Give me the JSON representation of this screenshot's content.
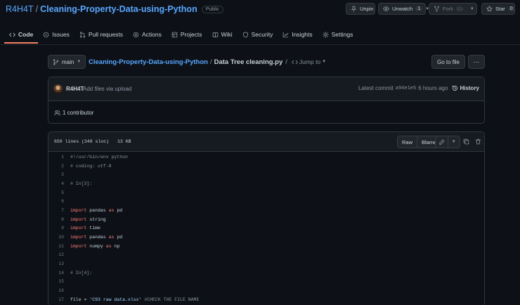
{
  "repo": {
    "owner": "R4H4T",
    "separator": "/",
    "name": "Cleaning-Property-Data-using-Python",
    "visibility": "Public"
  },
  "header_actions": {
    "unpin": "Unpin",
    "unwatch": "Unwatch",
    "watch_count": "1",
    "fork": "Fork",
    "fork_count": "0",
    "star": "Star",
    "star_count": "0"
  },
  "nav": {
    "code": "Code",
    "issues": "Issues",
    "pull_requests": "Pull requests",
    "actions": "Actions",
    "projects": "Projects",
    "wiki": "Wiki",
    "security": "Security",
    "insights": "Insights",
    "settings": "Settings"
  },
  "branch": {
    "name": "main"
  },
  "breadcrumb": {
    "repo": "Cleaning-Property-Data-using-Python",
    "slash": "/",
    "file": "Data Tree cleaning.py",
    "slash2": "/",
    "jump": "Jump to"
  },
  "goto_file": "Go to file",
  "more_options": "···",
  "commit": {
    "author": "R4H4T",
    "message": "Add files via upload",
    "latest_label": "Latest commit",
    "sha": "a94e1e5",
    "time": "6 hours ago",
    "history": "History"
  },
  "contributors": "1 contributor",
  "file": {
    "lines": "650 lines (348 sloc)",
    "size": "13 KB",
    "raw": "Raw",
    "blame": "Blame"
  },
  "code_lines": [
    {
      "n": "1",
      "text": "#!/usr/bin/env python"
    },
    {
      "n": "2",
      "text": "# coding: utf-8"
    },
    {
      "n": "3",
      "text": ""
    },
    {
      "n": "4",
      "text": "# In[3]:"
    },
    {
      "n": "5",
      "text": ""
    },
    {
      "n": "6",
      "text": ""
    },
    {
      "n": "7",
      "text": "import pandas as pd"
    },
    {
      "n": "8",
      "text": "import string"
    },
    {
      "n": "9",
      "text": "import time"
    },
    {
      "n": "10",
      "text": "import pandas as pd"
    },
    {
      "n": "11",
      "text": "import numpy as np"
    },
    {
      "n": "12",
      "text": ""
    },
    {
      "n": "13",
      "text": ""
    },
    {
      "n": "14",
      "text": "# In[4]:"
    },
    {
      "n": "15",
      "text": ""
    },
    {
      "n": "16",
      "text": ""
    },
    {
      "n": "17",
      "text": "file = 'C93 raw data.xlsx' #CHECK THE FILE NAME"
    }
  ],
  "colors": {
    "link": "#58a6ff",
    "keyword": "#ff7b72",
    "comment": "#8b949e",
    "string": "#a5d6ff",
    "active_tab": "#f78166",
    "background": "#0d1117"
  }
}
